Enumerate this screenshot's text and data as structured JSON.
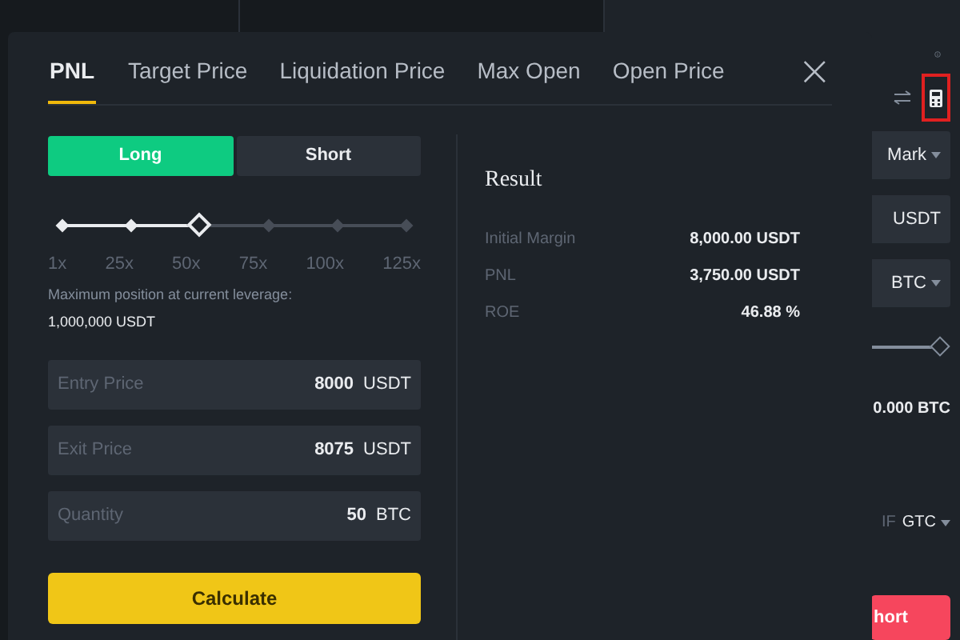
{
  "background_panel": {
    "price_type": "Mark",
    "amount_unit": "USDT",
    "size_unit": "BTC",
    "size_value": "0.000 BTC",
    "tif_label": "IF",
    "tif_value": "GTC",
    "short_button": "hort",
    "size_slider": {
      "level": 1
    }
  },
  "dialog": {
    "tabs": [
      {
        "label": "PNL",
        "selected": true
      },
      {
        "label": "Target Price",
        "selected": false
      },
      {
        "label": "Liquidation Price",
        "selected": false
      },
      {
        "label": "Max Open",
        "selected": false
      },
      {
        "label": "Open Price",
        "selected": false
      }
    ],
    "close": "×",
    "sides": [
      {
        "label": "Long",
        "selected": true
      },
      {
        "label": "Short",
        "selected": false
      }
    ],
    "leverage": {
      "level": 0.4,
      "ticks": [
        "1x",
        "25x",
        "50x",
        "75x",
        "100x",
        "125x"
      ]
    },
    "max_position_label": "Maximum position at current leverage:",
    "max_position_value": "1,000,000 USDT",
    "fields": [
      {
        "label": "Entry Price",
        "value": "8000",
        "unit": "USDT"
      },
      {
        "label": "Exit Price",
        "value": "8075",
        "unit": "USDT"
      },
      {
        "label": "Quantity",
        "value": "50",
        "unit": "BTC"
      }
    ],
    "calculate_button": "Calculate",
    "result": {
      "title": "Result",
      "rows": [
        {
          "label": "Initial Margin",
          "value": "8,000.00 USDT"
        },
        {
          "label": "PNL",
          "value": "3,750.00 USDT"
        },
        {
          "label": "ROE",
          "value": "46.88 %"
        }
      ]
    }
  }
}
